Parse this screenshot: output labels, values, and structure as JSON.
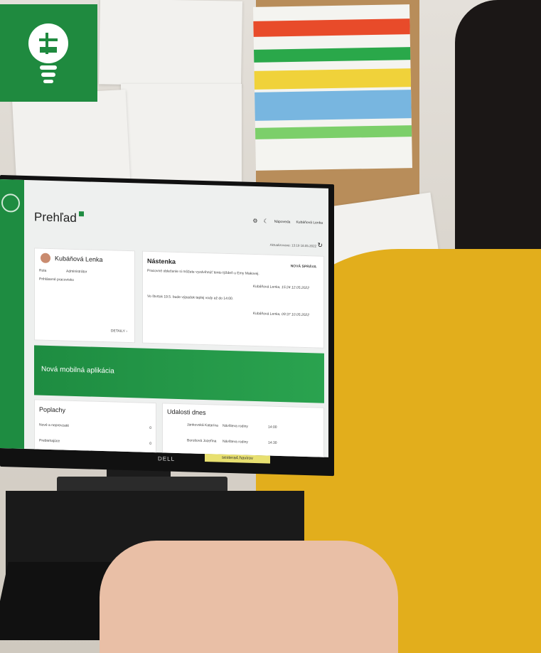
{
  "screen": {
    "page_title": "Prehľad",
    "help_label": "Nápoveda",
    "user_menu": "Kubáňová Lenka",
    "updated": "Aktualizované: 13:19 18.05.2022",
    "profile": {
      "name": "Kubáňová Lenka",
      "role_label": "Rola",
      "role_value": "Administrátor",
      "logged_label": "Prihlásené pracovisko",
      "details_button": "DETAILY"
    },
    "board": {
      "title": "Nástenka",
      "new_button": "NOVÁ SPRÁVA",
      "messages": [
        {
          "text": "Pracovné oblečenie si môžete vyzdvihnúť tento týždeň u Emy Makovej.",
          "meta": "Kubáňová Lenka, 15:24 12.05.2022"
        },
        {
          "text": "Vo štvrtok 19.5. bude výpadok teplej vody až do 14:00.",
          "meta": "Kubáňová Lenka, 09:37 10.05.2022"
        }
      ]
    },
    "banner": "Nová mobilná aplikácia",
    "alarms": {
      "title": "Poplachy",
      "rows": [
        {
          "label": "Nové a neprevzaté",
          "value": "0"
        },
        {
          "label": "Prebiehajúce",
          "value": "0"
        }
      ]
    },
    "events": {
      "title": "Udalosti dnes",
      "rows": [
        {
          "name": "Jankovská Katarína",
          "type": "Návšteva rodiny",
          "time": "14:00"
        },
        {
          "name": "Borošová Jozefína",
          "type": "Návšteva rodiny",
          "time": "14:30"
        }
      ]
    }
  },
  "monitor": {
    "brand": "DELL",
    "label_sticker": "sestera4.havirov"
  },
  "colors": {
    "brand_green": "#1f8a3f",
    "shirt_yellow": "#e2ae1c"
  },
  "icons": [
    "lightbulb-puzzle-icon",
    "gear-icon",
    "moon-icon",
    "refresh-icon",
    "pencil-icon",
    "chevron-right-icon"
  ]
}
